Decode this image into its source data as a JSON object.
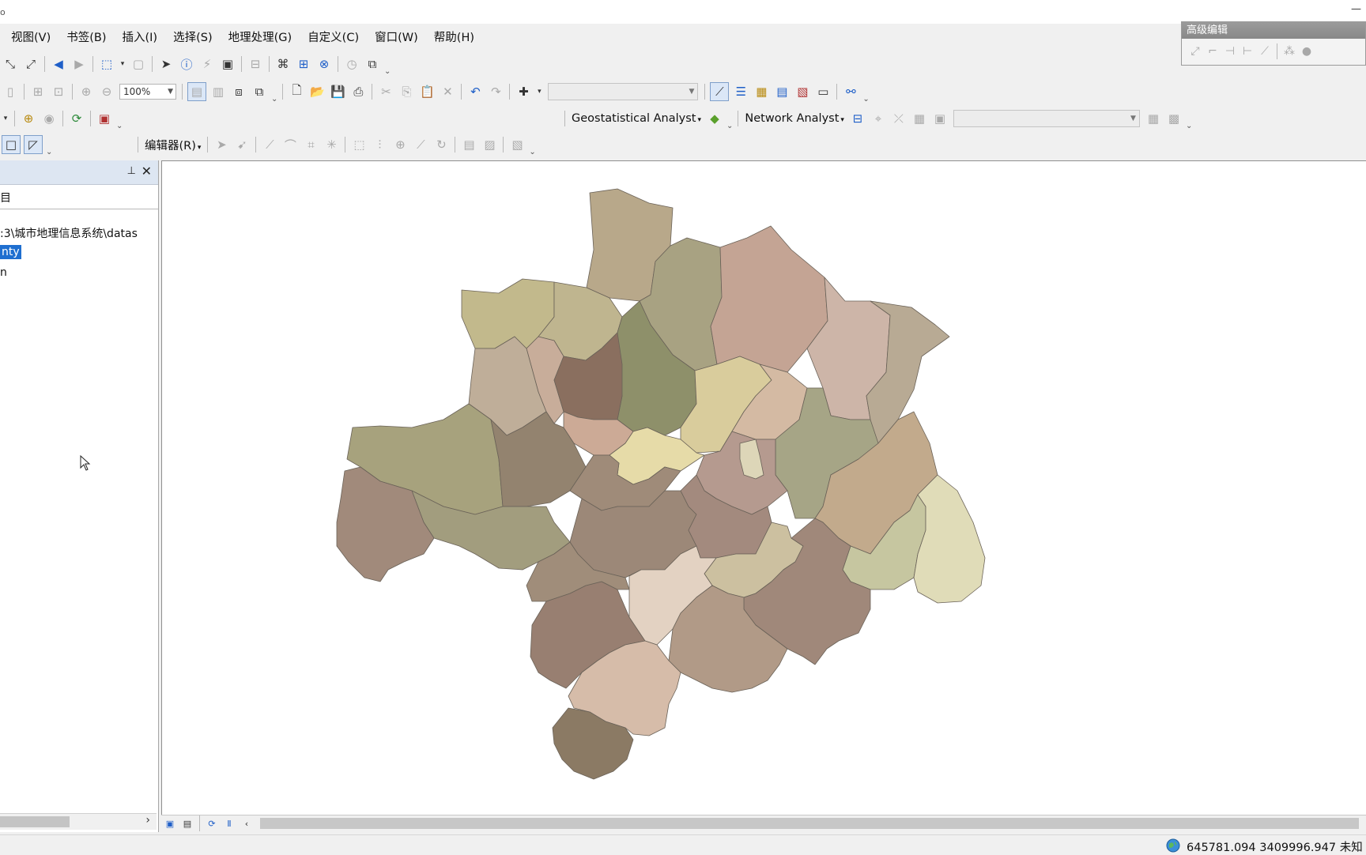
{
  "window": {
    "corner_glyph": "o",
    "minimize_glyph": "—"
  },
  "menu": {
    "items": [
      {
        "label": "视图(V)"
      },
      {
        "label": "书签(B)"
      },
      {
        "label": "插入(I)"
      },
      {
        "label": "选择(S)"
      },
      {
        "label": "地理处理(G)"
      },
      {
        "label": "自定义(C)"
      },
      {
        "label": "窗口(W)"
      },
      {
        "label": "帮助(H)"
      }
    ]
  },
  "toolbar_standard": {
    "zoom_value": "100%"
  },
  "toolbar_analyst": {
    "geostatistical_label": "Geostatistical Analyst",
    "network_label": "Network Analyst"
  },
  "toolbar_editor": {
    "editor_label": "编辑器(R)"
  },
  "advanced_editing": {
    "title": "高级编辑"
  },
  "sidebar": {
    "tab_label": "目",
    "path_text": ":3\\城市地理信息系统\\datas",
    "selected_item": "nty",
    "item3": "n"
  },
  "status": {
    "coords": "645781.094  3409996.947 未知"
  },
  "map": {
    "regions": [
      {
        "name": "r1",
        "fill": "#b8a88a"
      },
      {
        "name": "r2",
        "fill": "#a8a282"
      },
      {
        "name": "r3",
        "fill": "#c4a494"
      },
      {
        "name": "r4",
        "fill": "#cdb5a8"
      },
      {
        "name": "r5",
        "fill": "#b8aa94"
      },
      {
        "name": "r6",
        "fill": "#c2b98c"
      },
      {
        "name": "r7",
        "fill": "#bfb58f"
      },
      {
        "name": "r8",
        "fill": "#8e906a"
      },
      {
        "name": "r9",
        "fill": "#c8ad9a"
      },
      {
        "name": "r10",
        "fill": "#8a6f5f"
      },
      {
        "name": "r11",
        "fill": "#bfae99"
      },
      {
        "name": "r12",
        "fill": "#d9cc9c"
      },
      {
        "name": "r13",
        "fill": "#d4baa3"
      },
      {
        "name": "r14",
        "fill": "#a6a586"
      },
      {
        "name": "r15",
        "fill": "#c2aa8c"
      },
      {
        "name": "r16",
        "fill": "#a7a27d"
      },
      {
        "name": "r17",
        "fill": "#93836f"
      },
      {
        "name": "r18",
        "fill": "#ccaa96"
      },
      {
        "name": "r19",
        "fill": "#e6dba8"
      },
      {
        "name": "r20",
        "fill": "#9f8b79"
      },
      {
        "name": "r21",
        "fill": "#b59a8f"
      },
      {
        "name": "r22",
        "fill": "#ddd6b8"
      },
      {
        "name": "r23",
        "fill": "#a29d7e"
      },
      {
        "name": "r24",
        "fill": "#a18a7b"
      },
      {
        "name": "r25",
        "fill": "#9c8878"
      },
      {
        "name": "r26",
        "fill": "#a38a7e"
      },
      {
        "name": "r27",
        "fill": "#ccc0a0"
      },
      {
        "name": "r28",
        "fill": "#c6c6a0"
      },
      {
        "name": "r29",
        "fill": "#e0dcb8"
      },
      {
        "name": "r30",
        "fill": "#a0887a"
      },
      {
        "name": "r31",
        "fill": "#987f71"
      },
      {
        "name": "r32",
        "fill": "#e3d2c2"
      },
      {
        "name": "r33",
        "fill": "#b19a87"
      },
      {
        "name": "r34",
        "fill": "#d6bca9"
      },
      {
        "name": "r35",
        "fill": "#8b7a64"
      },
      {
        "name": "r36",
        "fill": "#a08d7a"
      }
    ]
  }
}
